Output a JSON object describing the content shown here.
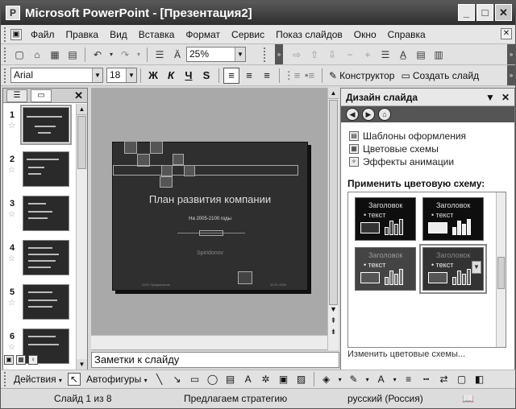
{
  "window": {
    "title": "Microsoft PowerPoint - [Презентация2]",
    "app_icon": "P"
  },
  "menu": {
    "items": [
      "Файл",
      "Правка",
      "Вид",
      "Вставка",
      "Формат",
      "Сервис",
      "Показ слайдов",
      "Окно",
      "Справка"
    ]
  },
  "standard_toolbar": {
    "zoom": "25%"
  },
  "formatting_toolbar": {
    "font": "Arial",
    "size": "18",
    "bold": "Ж",
    "italic": "К",
    "underline": "Ч",
    "shadow": "S",
    "designer": "Конструктор",
    "new_slide": "Создать слайд"
  },
  "slides": [
    {
      "num": "1"
    },
    {
      "num": "2"
    },
    {
      "num": "3"
    },
    {
      "num": "4"
    },
    {
      "num": "5"
    },
    {
      "num": "6"
    }
  ],
  "slide": {
    "title": "План развития компании",
    "subtitle": "На 2005-2100 годы",
    "author": "Spiridonov",
    "footer_left": "ООО Предприятие",
    "footer_right": "10.01.2005"
  },
  "notes": {
    "placeholder": "Заметки к слайду"
  },
  "task_pane": {
    "title": "Дизайн слайда",
    "links": [
      "Шаблоны оформления",
      "Цветовые схемы",
      "Эффекты анимации"
    ],
    "apply_label": "Применить цветовую схему:",
    "scheme_title": "Заголовок",
    "scheme_text": "• текст",
    "change_link": "Изменить цветовые схемы..."
  },
  "drawing_toolbar": {
    "actions": "Действия",
    "autoshapes": "Автофигуры"
  },
  "status": {
    "slide_info": "Слайд 1 из 8",
    "design": "Предлагаем стратегию",
    "language": "русский (Россия)"
  }
}
